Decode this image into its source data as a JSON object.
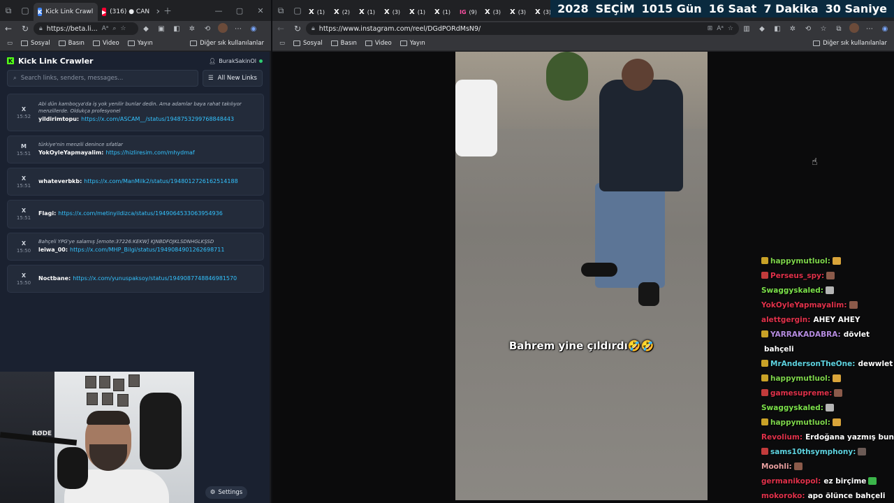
{
  "left_window": {
    "tabs": [
      {
        "label": "Kick Link Crawl",
        "favicon": "K"
      },
      {
        "label": "(316) ● CAN",
        "favicon": "▶"
      }
    ],
    "url": "https://beta.li...",
    "bookmarks": [
      "Sosyal",
      "Basın",
      "Video",
      "Yayın"
    ],
    "bookmarks_other": "Diğer sık kullanılanlar"
  },
  "app": {
    "title": "Kick Link Crawler",
    "user": "BurakSakinOl",
    "search_placeholder": "Search links, senders, messages...",
    "filter_label": "All New Links",
    "settings_label": "Settings",
    "items": [
      {
        "platform": "X",
        "time": "15:52",
        "quote": "Abi dün kamboçya'da iş yok yenilir bunlar dedin. Ama adamlar baya rahat takılıyor menzillerde. Oldukça profesyonel",
        "sender": "yildirimtopu:",
        "link": "https://x.com/ASCAM__/status/1948753299768848443"
      },
      {
        "platform": "M",
        "time": "15:51",
        "quote": "türkiye'nin menzili denince sıfatlar",
        "sender": "YokOyleYapmayalim:",
        "link": "https://hizliresim.com/mhydmaf"
      },
      {
        "platform": "X",
        "time": "15:51",
        "quote": "",
        "sender": "whateverbkb:",
        "link": "https://x.com/ManMilk2/status/1948012726162514188"
      },
      {
        "platform": "X",
        "time": "15:51",
        "quote": "",
        "sender": "Flagi:",
        "link": "https://x.com/metinyildizca/status/1949064533063954936"
      },
      {
        "platform": "X",
        "time": "15:50",
        "quote": "Bahçeli YPG'ye salamış [emote:37226:KEKW] KJNBDFOJKLSDNHGLKŞSD",
        "sender": "leiwa_00:",
        "link": "https://x.com/MHP_Bilgi/status/1949084901262698711"
      },
      {
        "platform": "X",
        "time": "15:50",
        "quote": "",
        "sender": "Noctbane:",
        "link": "https://x.com/yunuspaksoy/status/1949087748846981570"
      }
    ]
  },
  "webcam": {
    "mic_brand": "RØDE"
  },
  "right_window": {
    "tabs": [
      {
        "icon": "X",
        "count": "(1)"
      },
      {
        "icon": "X",
        "count": "(2)"
      },
      {
        "icon": "X",
        "count": "(1)"
      },
      {
        "icon": "X",
        "count": "(3)"
      },
      {
        "icon": "X",
        "count": "(1)"
      },
      {
        "icon": "X",
        "count": "(1)"
      },
      {
        "icon": "IG",
        "count": "(9)"
      },
      {
        "icon": "X",
        "count": "(3)"
      },
      {
        "icon": "X",
        "count": "(3)"
      },
      {
        "icon": "X",
        "count": "(3)"
      }
    ],
    "url": "https://www.instagram.com/reel/DGdPORdMsN9/",
    "bookmarks": [
      "Sosyal",
      "Basın",
      "Video",
      "Yayın"
    ],
    "bookmarks_other": "Diğer sık kullanılanlar"
  },
  "countdown": {
    "year": "2028",
    "label": "SEÇİM",
    "days": "1015",
    "days_unit": "Gün",
    "hours": "16",
    "hours_unit": "Saat",
    "minutes": "7",
    "minutes_unit": "Dakika",
    "seconds": "30",
    "seconds_unit": "Saniye"
  },
  "reel": {
    "caption": "Bahrem yine çıldırdı🤣🤣"
  },
  "chat": [
    {
      "user": "happymutluol:",
      "color": "#7dd44a",
      "badge": "#c9a227",
      "msg": "",
      "emote": "#d9a43a"
    },
    {
      "user": "Perseus_spy:",
      "color": "#e0314a",
      "badge": "#c23b3b",
      "msg": "",
      "emote": "#8b5a4a"
    },
    {
      "user": "Swaggyskaled:",
      "color": "#7be04a",
      "badge": "",
      "msg": "",
      "emote": "#b5b5b5"
    },
    {
      "user": "YokOyleYapmayalim:",
      "color": "#e0314a",
      "badge": "",
      "msg": "",
      "emote": "#8b5a4a"
    },
    {
      "user": "alettgergin:",
      "color": "#e0314a",
      "badge": "",
      "msg": "AHEY AHEY",
      "emote": ""
    },
    {
      "user": "YARRAKADABRA:",
      "color": "#b58ce0",
      "badge": "#c9a227",
      "msg": "dövlet",
      "emote": ""
    },
    {
      "user": "",
      "color": "#ffffff",
      "badge": "",
      "msg": "bahçeli",
      "emote": ""
    },
    {
      "user": "MrAndersonTheOne:",
      "color": "#5ed3e0",
      "badge": "#c9a227",
      "msg": "dewwlet",
      "emote": ""
    },
    {
      "user": "happymutluol:",
      "color": "#7dd44a",
      "badge": "#c9a227",
      "msg": "",
      "emote": "#d9a43a"
    },
    {
      "user": "gamesupreme:",
      "color": "#e0314a",
      "badge": "#c23b3b",
      "msg": "",
      "emote": "#8b5a4a"
    },
    {
      "user": "Swaggyskaled:",
      "color": "#7be04a",
      "badge": "",
      "msg": "",
      "emote": "#b5b5b5"
    },
    {
      "user": "happymutluol:",
      "color": "#7dd44a",
      "badge": "#c9a227",
      "msg": "",
      "emote": "#d9a43a"
    },
    {
      "user": "Revolium:",
      "color": "#e0314a",
      "badge": "",
      "msg": "Erdoğana yazmış bunu",
      "emote": ""
    },
    {
      "user": "sams10thsymphony:",
      "color": "#5ed3e0",
      "badge": "#c23b3b",
      "msg": "",
      "emote": "#6b5a55"
    },
    {
      "user": "Moohli:",
      "color": "#e8a0a0",
      "badge": "",
      "msg": "",
      "emote": "#8b5a4a"
    },
    {
      "user": "germanikopol:",
      "color": "#e0314a",
      "badge": "",
      "msg": "ez birçime",
      "emote": "#3bb54a"
    },
    {
      "user": "mokoroko:",
      "color": "#e0314a",
      "badge": "",
      "msg": "apo ölünce bahçeli",
      "emote": ""
    }
  ]
}
